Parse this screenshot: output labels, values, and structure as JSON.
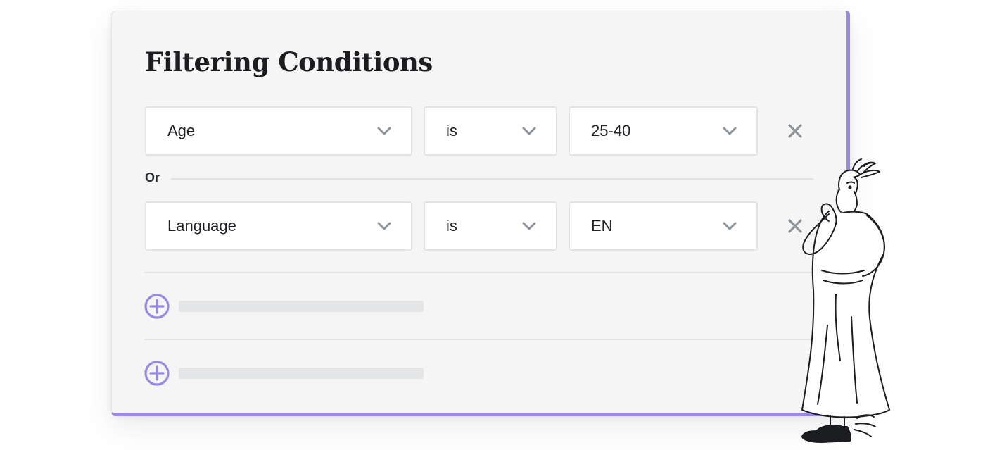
{
  "title": "Filtering Conditions",
  "conditions": [
    {
      "field": "Age",
      "operator": "is",
      "value": "25-40"
    },
    {
      "field": "Language",
      "operator": "is",
      "value": "EN"
    }
  ],
  "connector": "Or",
  "colors": {
    "accent": "#9b87ea",
    "panel_bg": "#f4f5f4",
    "border": "#e2e4e3",
    "icon_gray": "#8b939b",
    "text": "#1b1d21"
  },
  "icons": {
    "dropdown": "chevron-down-icon",
    "remove": "close-icon",
    "add": "plus-circle-icon",
    "illustration": "hermes-figure"
  }
}
